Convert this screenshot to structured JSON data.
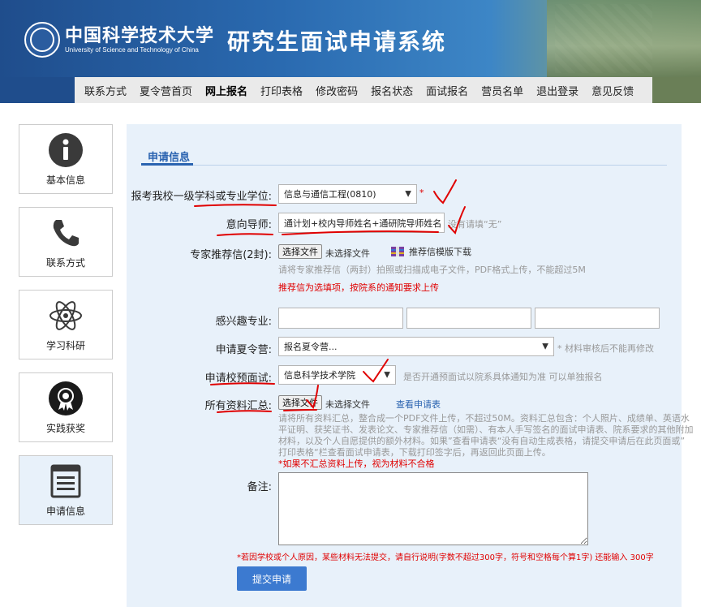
{
  "header": {
    "university_cn": "中国科学技术大学",
    "university_en": "University of Science and Technology of China",
    "system_title": "研究生面试申请系统"
  },
  "nav": {
    "items": [
      {
        "label": "联系方式"
      },
      {
        "label": "夏令营首页"
      },
      {
        "label": "网上报名",
        "active": true
      },
      {
        "label": "打印表格"
      },
      {
        "label": "修改密码"
      },
      {
        "label": "报名状态"
      },
      {
        "label": "面试报名"
      },
      {
        "label": "营员名单"
      },
      {
        "label": "退出登录"
      },
      {
        "label": "意见反馈"
      }
    ]
  },
  "sidebar": {
    "items": [
      {
        "label": "基本信息",
        "icon": "info-icon"
      },
      {
        "label": "联系方式",
        "icon": "phone-icon"
      },
      {
        "label": "学习科研",
        "icon": "atom-icon"
      },
      {
        "label": "实践获奖",
        "icon": "award-icon"
      },
      {
        "label": "申请信息",
        "icon": "form-icon",
        "active": true
      }
    ]
  },
  "form": {
    "section_title": "申请信息",
    "discipline": {
      "label": "报考我校一级学科或专业学位:",
      "value": "信息与通信工程(0810)",
      "required_mark": "*"
    },
    "advisor": {
      "label": "意向导师:",
      "value": "通计划+校内导师姓名+通研院导师姓名",
      "hint": "没有请填“无”"
    },
    "recommendation": {
      "label": "专家推荐信(2封):",
      "button": "选择文件",
      "file_status": "未选择文件",
      "template_link": "推荐信模版下载",
      "hint": "请将专家推荐信（两封）拍照或扫描成电子文件，PDF格式上传，不能超过5M",
      "note": "推荐信为选填项，按院系的通知要求上传"
    },
    "interest": {
      "label": "感兴趣专业:",
      "values": [
        "",
        "",
        ""
      ]
    },
    "camp": {
      "label": "申请夏令营:",
      "value": "报名夏令营...",
      "hint": "* 材料审核后不能再修改"
    },
    "pre_interview": {
      "label": "申请校预面试:",
      "value": "信息科学技术学院",
      "hint": "是否开通预面试以院系具体通知为准 可以单独报名"
    },
    "materials": {
      "label": "所有资料汇总:",
      "button": "选择文件",
      "file_status": "未选择文件",
      "view_link": "查看申请表",
      "hint_lines": [
        "请将所有资料汇总，整合成一个PDF文件上传，不超过50M。资料汇总包含：个人照片、成绩单、英语水",
        "平证明、获奖证书、发表论文、专家推荐信（如需）、有本人手写签名的面试申请表、院系要求的其他附加",
        "材料，以及个人自愿提供的额外材料。如果”查看申请表“没有自动生成表格，请提交申请后在此页面或”",
        "打印表格“栏查看面试申请表，下载打印签字后，再返回此页面上传。"
      ],
      "warning": "*如果不汇总资料上传，视为材料不合格"
    },
    "remark": {
      "label": "备注:",
      "note": "*若因学校或个人原因，某些材料无法提交，请自行说明(字数不超过300字，符号和空格每个算1字) 还能输入 300字"
    },
    "submit_label": "提交申请"
  },
  "colors": {
    "accent": "#2a63b0",
    "warning": "#e00000",
    "annotation": "#e00000"
  }
}
